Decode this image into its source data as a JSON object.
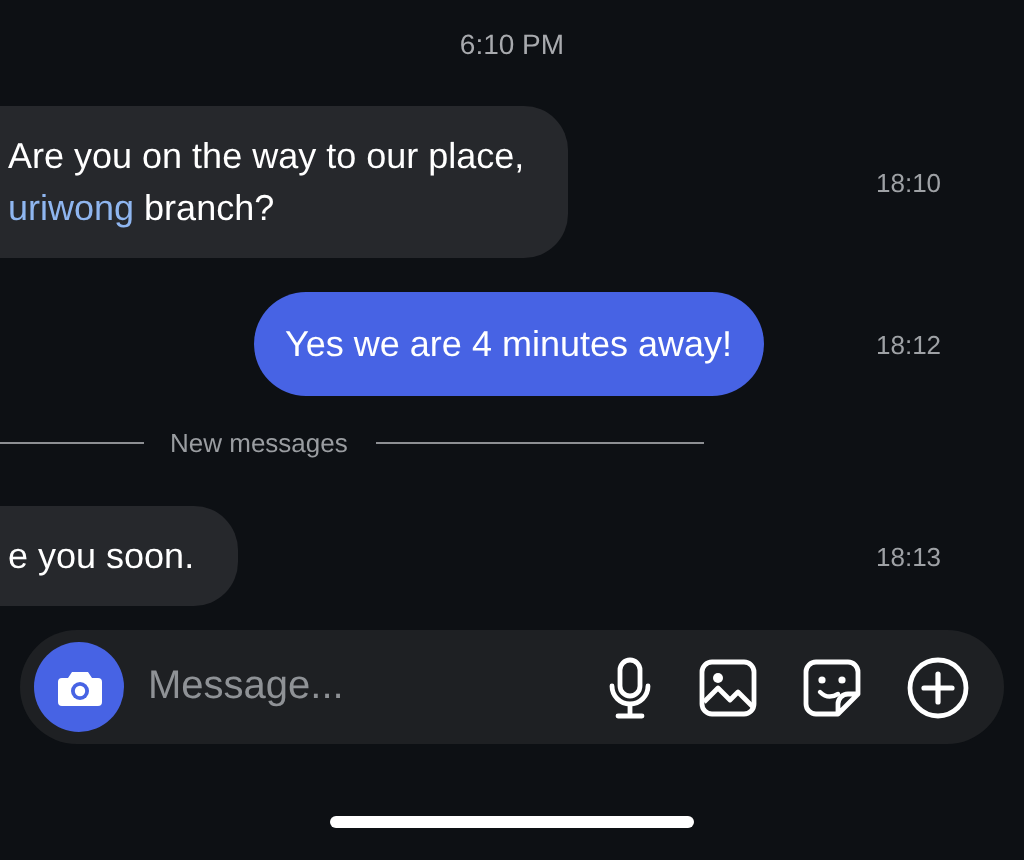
{
  "timestamp": "6:10 PM",
  "messages": [
    {
      "kind": "incoming",
      "time": "18:10",
      "lines": [
        [
          {
            "kind": "text",
            "text": "Are you on the way to our place,"
          }
        ],
        [
          {
            "kind": "link",
            "text": "uriwong"
          },
          {
            "kind": "text",
            "text": " branch?"
          }
        ]
      ]
    },
    {
      "kind": "outgoing",
      "time": "18:12",
      "lines": [
        [
          {
            "kind": "text",
            "text": "Yes we are 4 minutes away!"
          }
        ]
      ]
    },
    {
      "kind": "divider",
      "label": "New messages"
    },
    {
      "kind": "incoming",
      "time": "18:13",
      "lines": [
        [
          {
            "kind": "text",
            "text": "e you soon."
          }
        ]
      ]
    }
  ],
  "composer": {
    "placeholder": "Message..."
  }
}
